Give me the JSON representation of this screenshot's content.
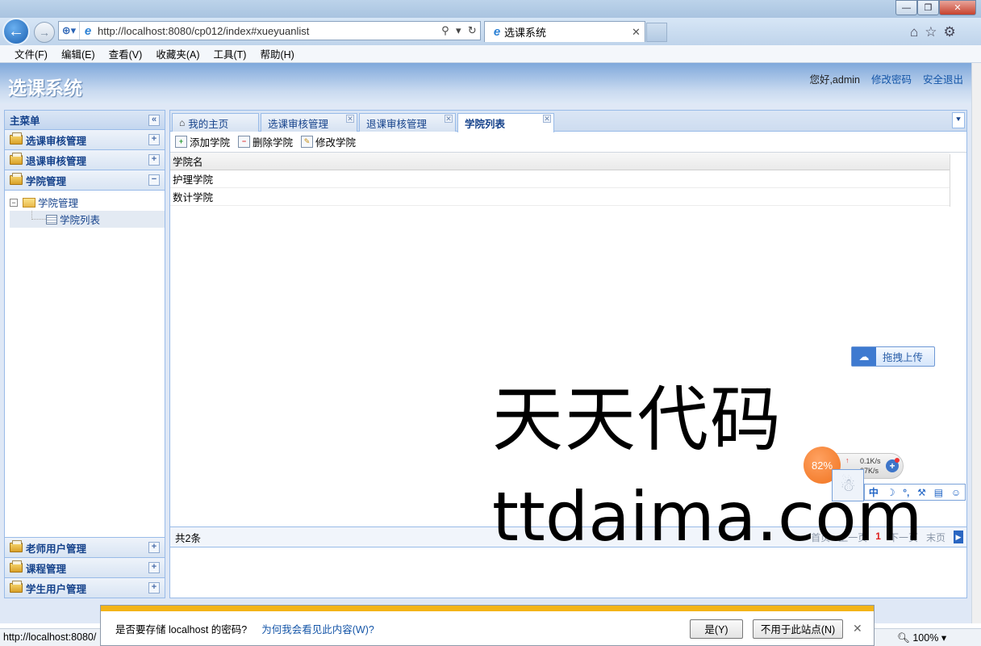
{
  "browser": {
    "url": "http://localhost:8080/cp012/index#xueyuanlist",
    "tab_title": "选课系统",
    "menu": [
      "文件(F)",
      "编辑(E)",
      "查看(V)",
      "收藏夹(A)",
      "工具(T)",
      "帮助(H)"
    ],
    "status_url": "http://localhost:8080/",
    "zoom": "100%"
  },
  "header": {
    "title": "选课系统",
    "greeting": "您好,admin",
    "change_password": "修改密码",
    "logout": "安全退出"
  },
  "sidebar": {
    "title": "主菜单",
    "sections_top": [
      {
        "label": "选课审核管理"
      },
      {
        "label": "退课审核管理"
      },
      {
        "label": "学院管理"
      }
    ],
    "tree": {
      "parent": "学院管理",
      "child": "学院列表"
    },
    "sections_bottom": [
      {
        "label": "老师用户管理"
      },
      {
        "label": "课程管理"
      },
      {
        "label": "学生用户管理"
      }
    ]
  },
  "tabs": [
    {
      "label": "我的主页"
    },
    {
      "label": "选课审核管理"
    },
    {
      "label": "退课审核管理"
    },
    {
      "label": "学院列表"
    }
  ],
  "toolbar": {
    "add": "添加学院",
    "delete": "删除学院",
    "edit": "修改学院"
  },
  "grid": {
    "column": "学院名",
    "rows": [
      "护理学院",
      "数计学院"
    ]
  },
  "pager": {
    "total": "共2条",
    "first": "首页",
    "prev": "上一页",
    "current": "1",
    "next": "下一页",
    "last": "末页"
  },
  "upload": {
    "label": "拖拽上传"
  },
  "speed": {
    "percent": "82%",
    "up": "0.1K/s",
    "down": "07K/s"
  },
  "qq_bar": {
    "items": [
      "中",
      "☽",
      "°,",
      "⚒",
      "▤",
      "☺"
    ]
  },
  "watermark": {
    "line1": "天天代码",
    "line2": "ttdaima.com"
  },
  "notification": {
    "message": "是否要存储 localhost 的密码?",
    "link": "为何我会看见此内容(W)?",
    "yes": "是(Y)",
    "never": "不用于此站点(N)"
  }
}
